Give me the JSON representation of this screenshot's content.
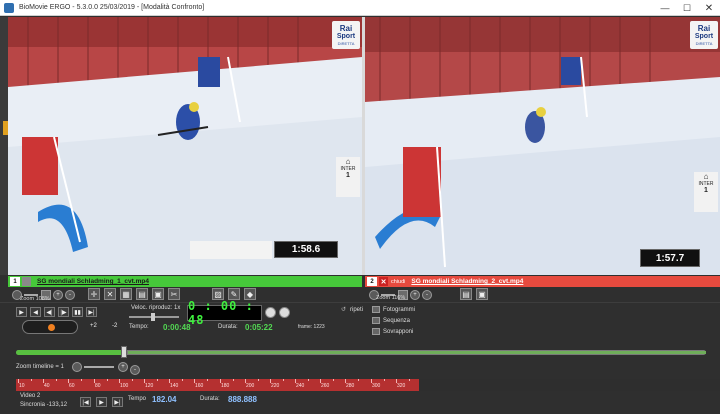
{
  "window": {
    "title": "BioMovie ERGO - 5.3.0.0  25/03/2019 - [Modalità Confronto]",
    "minimize": "—",
    "maximize": "☐",
    "close": "✕"
  },
  "video_left": {
    "timer": "1:58.6",
    "logo_line1": "Rai",
    "logo_line2": "Sport",
    "logo_line3": "DIRETTA",
    "rank_label": "INTER",
    "rank_num": "1"
  },
  "video_right": {
    "timer": "1:57.7",
    "logo_line1": "Rai",
    "logo_line2": "Sport",
    "logo_line3": "DIRETTA",
    "rank_label": "INTER",
    "rank_num": "1"
  },
  "clip_left": {
    "number": "1",
    "filename": "SG mondiali Schladming_1_cvt.mp4",
    "zoom": "Zoom 108%"
  },
  "clip_right": {
    "number": "2",
    "close_label": "chiudi",
    "filename": "SG mondiali Schladming_2_cvt.mp4",
    "zoom": "Zoom 116%"
  },
  "transport": {
    "speed_label": "Veloc. riproduz: 1x",
    "lcd_time": "0 : 00 : 48",
    "plus2": "+2",
    "minus2": "-2",
    "tempo_label": "Tempo:",
    "tempo_value": "0:00:48",
    "durata_label": "Durata:",
    "durata_value": "0:05:22",
    "frame_label": "frame: 1223",
    "ripeti_label": "ripeti"
  },
  "options": {
    "fotogrammi": "Fotogrammi",
    "sequenza": "Sequenza",
    "sovrapponi": "Sovrapponi"
  },
  "timeline": {
    "zoom_label": "Zoom timeline = 1",
    "position": 0.156,
    "ruler_labels": [
      "10",
      "40",
      "60",
      "80",
      "100",
      "120",
      "140",
      "160",
      "180",
      "200",
      "220",
      "240",
      "260",
      "280",
      "300",
      "320"
    ]
  },
  "bottom": {
    "video_label": "Video 2",
    "sync_label": "Sincronia -133,12",
    "tempo_label": "Tempo",
    "tempo_value": "182.04",
    "durata_label": "Durata:",
    "durata_value": "888.888"
  },
  "colors": {
    "left_clip": "#46c83a",
    "right_clip": "#e64a3e",
    "timeline_progress": "#58c040",
    "ruler": "#b53030",
    "lcd_text": "#3ef03e"
  }
}
